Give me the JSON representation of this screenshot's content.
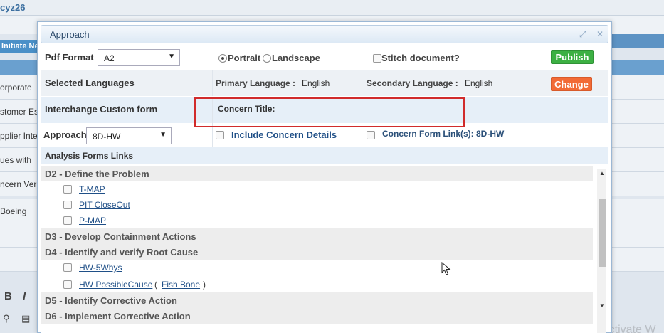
{
  "background": {
    "title": "cyz26",
    "initiate_button": "Initiate Ne",
    "rows": [
      "orporate",
      "stomer Es",
      "pplier Inte",
      "ues with",
      "ncern Ver",
      "Boeing"
    ],
    "watermark": "Activate W"
  },
  "dialog": {
    "title": "Approach",
    "pdf_format_label": "Pdf Format",
    "pdf_format_value": "A2",
    "orientation": {
      "portrait": "Portrait",
      "landscape": "Landscape",
      "selected": "Portrait"
    },
    "stitch_label": "Stitch document?",
    "publish_label": "Publish",
    "selected_languages_label": "Selected Languages",
    "primary_language_label": "Primary Language :",
    "primary_language_value": "English",
    "secondary_language_label": "Secondary Language :",
    "secondary_language_value": "English",
    "change_label": "Change",
    "interchange_label": "Interchange Custom form",
    "concern_title_label": "Concern Title:",
    "approach_label": "Approach",
    "approach_value": "8D-HW",
    "include_details_label": "Include Concern Details",
    "concern_links_label": "Concern Form Link(s): 8D-HW",
    "analysis_links_label": "Analysis Forms Links",
    "sections": {
      "d2": "D2 - Define the Problem",
      "d3": "D3 - Develop Containment Actions",
      "d4": "D4 - Identify and verify Root Cause",
      "d5": "D5 - Identify Corrective Action",
      "d6": "D6 - Implement Corrective Action"
    },
    "items": {
      "tmap": "T-MAP",
      "pit": "PIT CloseOut",
      "pmap": "P-MAP",
      "hw5": "HW-5Whys",
      "hwpc": "HW PossibleCause",
      "fishbone": "Fish Bone",
      "paren_open": "(",
      "paren_close": ")"
    }
  },
  "colors": {
    "accent": "#4a90c8",
    "publish": "#3cb043",
    "change": "#f26a36",
    "highlight": "#d12b2b"
  }
}
